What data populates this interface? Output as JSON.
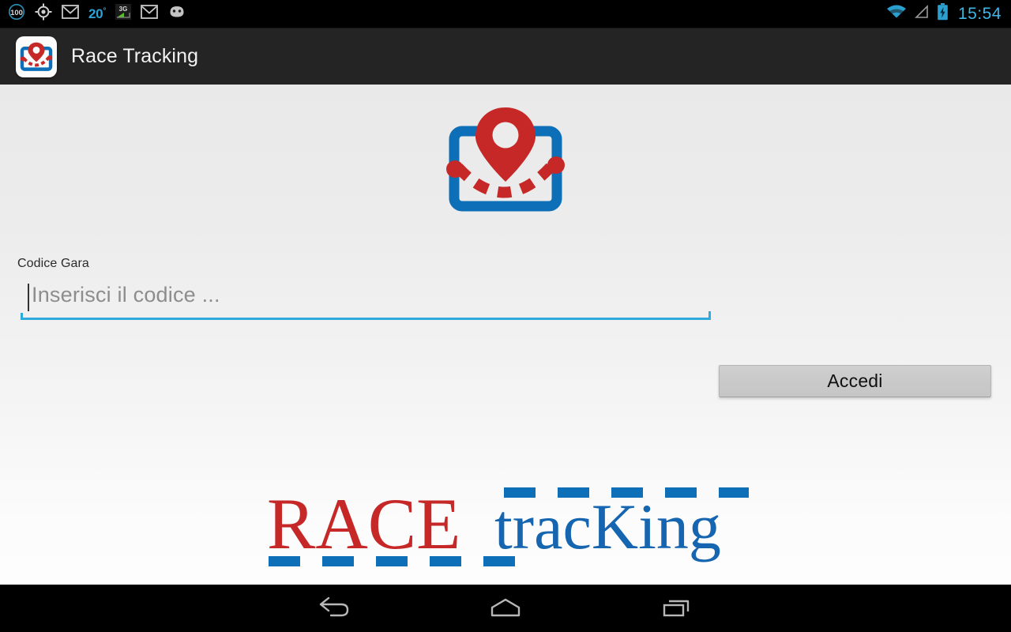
{
  "status_bar": {
    "battery_percent_label": "100",
    "temperature": "20",
    "temperature_degree": "°",
    "network_label": "3G",
    "clock": "15:54",
    "icons": [
      {
        "name": "battery-percent-icon",
        "label": "100"
      },
      {
        "name": "gps-location-icon",
        "label": "GPS"
      },
      {
        "name": "gmail-icon",
        "label": "M"
      },
      {
        "name": "weather-temperature-icon",
        "label": "20°"
      },
      {
        "name": "network-3g-icon",
        "label": "3G"
      },
      {
        "name": "gmail-icon-2",
        "label": "M"
      },
      {
        "name": "android-head-icon",
        "label": "Android"
      },
      {
        "name": "wifi-icon",
        "label": "WiFi"
      },
      {
        "name": "cell-signal-icon",
        "label": "Signal"
      },
      {
        "name": "battery-charging-icon",
        "label": "Charging"
      }
    ]
  },
  "action_bar": {
    "title": "Race Tracking",
    "app_icon_name": "race-tracking-app-icon"
  },
  "main": {
    "hero_logo_name": "race-tracking-hero-logo",
    "field_label": "Codice Gara",
    "input_placeholder": "Inserisci il codice ...",
    "input_value": "",
    "submit_label": "Accedi",
    "wordmark": {
      "part_red": "RACE",
      "part_blue": "tracKing",
      "full": "RACEtracKing",
      "dash_count_bottom": 5,
      "dash_count_top": 5
    }
  },
  "nav_bar": {
    "back_label": "Back",
    "home_label": "Home",
    "recents_label": "Recent apps"
  },
  "colors": {
    "brand_red": "#c62828",
    "brand_blue": "#0d6fb8",
    "accent_blue": "#2eaadc",
    "status_clock": "#3eb6e8",
    "action_bar_bg": "#242424",
    "content_bg_top": "#e9e9e9",
    "content_bg_bottom": "#fdfdfd"
  }
}
